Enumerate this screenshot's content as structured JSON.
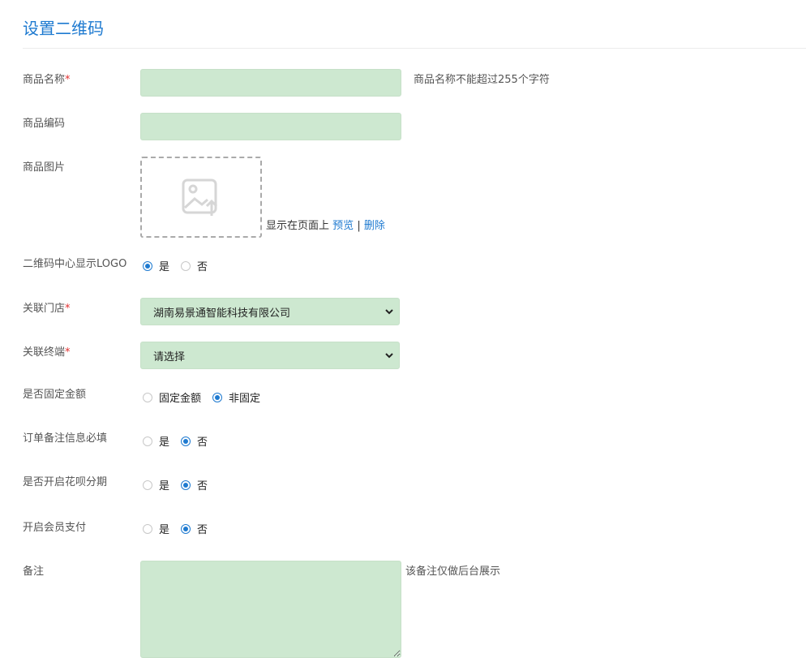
{
  "page_title": "设置二维码",
  "required_mark": "*",
  "product_name": {
    "label": "商品名称",
    "value": "",
    "hint": "商品名称不能超过255个字符"
  },
  "product_code": {
    "label": "商品编码",
    "value": ""
  },
  "product_image": {
    "label": "商品图片",
    "note": "显示在页面上",
    "preview": "预览",
    "separator": "|",
    "delete": "删除"
  },
  "logo_center": {
    "label": "二维码中心显示LOGO",
    "options": [
      "是",
      "否"
    ],
    "selected": "是"
  },
  "store": {
    "label": "关联门店",
    "value": "湖南易景通智能科技有限公司"
  },
  "terminal": {
    "label": "关联终端",
    "value": "请选择"
  },
  "fixed_amount": {
    "label": "是否固定金额",
    "options": [
      "固定金额",
      "非固定"
    ],
    "selected": "非固定"
  },
  "order_note_required": {
    "label": "订单备注信息必填",
    "options": [
      "是",
      "否"
    ],
    "selected": "否"
  },
  "huabei_installments": {
    "label": "是否开启花呗分期",
    "options": [
      "是",
      "否"
    ],
    "selected": "否"
  },
  "member_payment": {
    "label": "开启会员支付",
    "options": [
      "是",
      "否"
    ],
    "selected": "否"
  },
  "remark": {
    "label": "备注",
    "value": "",
    "hint": "该备注仅做后台展示"
  }
}
